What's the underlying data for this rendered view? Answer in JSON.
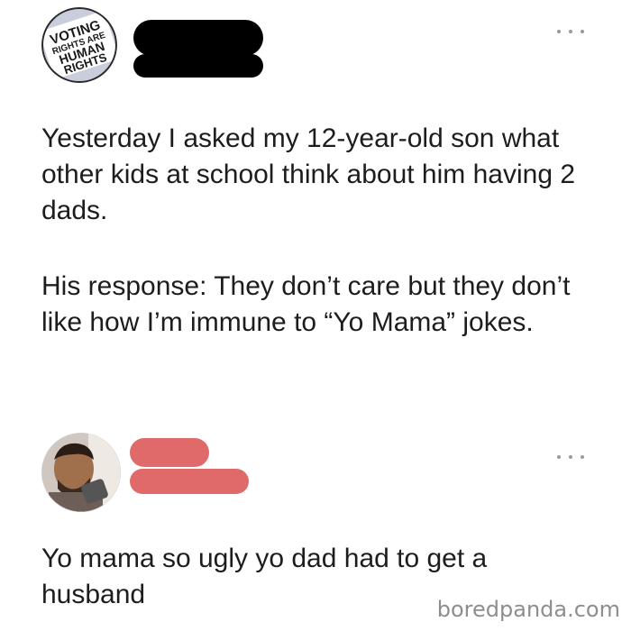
{
  "post1": {
    "avatar_badge_lines": [
      "VOTING",
      "RIGHTS ARE",
      "HUMAN",
      "RIGHTS"
    ],
    "paragraph1": "Yesterday I asked my 12-year-old son what other kids at school think about him having 2 dads.",
    "paragraph2": "His response: They don’t care but they don’t like how I’m immune to “Yo Mama” jokes.",
    "redaction_color": "#000000",
    "more_icon": "more-horizontal-icon"
  },
  "post2": {
    "reply_text": "Yo mama so ugly yo dad had to get a husband",
    "redaction_color": "#e06a6a",
    "more_icon": "more-horizontal-icon"
  },
  "watermark": "boredpanda.com"
}
